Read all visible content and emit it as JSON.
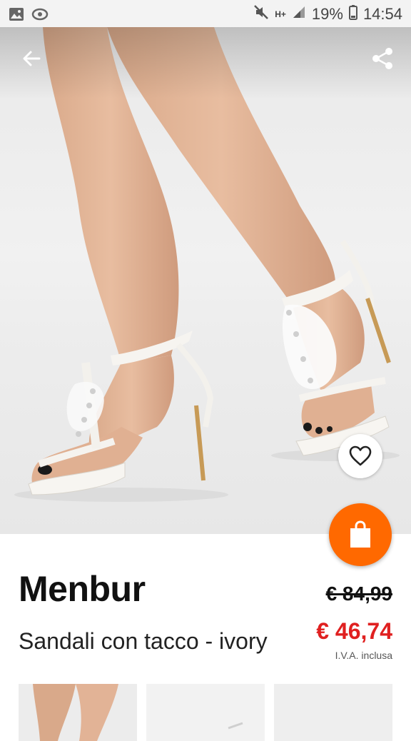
{
  "status_bar": {
    "network": "H+",
    "battery": "19%",
    "time": "14:54",
    "icons": [
      "gallery-icon",
      "sync-icon",
      "mute-icon",
      "network-icon",
      "signal-icon",
      "battery-icon"
    ]
  },
  "top_bar": {
    "back_icon": "arrow-left-icon",
    "share_icon": "share-icon"
  },
  "product": {
    "brand": "Menbur",
    "name": "Sandali con tacco - ivory",
    "old_price": "€ 84,99",
    "new_price": "€ 46,74",
    "vat_note": "I.V.A. inclusa"
  },
  "actions": {
    "favorite_icon": "heart-icon",
    "cart_icon": "shopping-bag-icon"
  },
  "colors": {
    "accent": "#ff6900",
    "sale_price": "#e02020"
  },
  "thumbnails": [
    {
      "label": "thumbnail-1"
    },
    {
      "label": "thumbnail-2"
    },
    {
      "label": "thumbnail-3"
    }
  ]
}
